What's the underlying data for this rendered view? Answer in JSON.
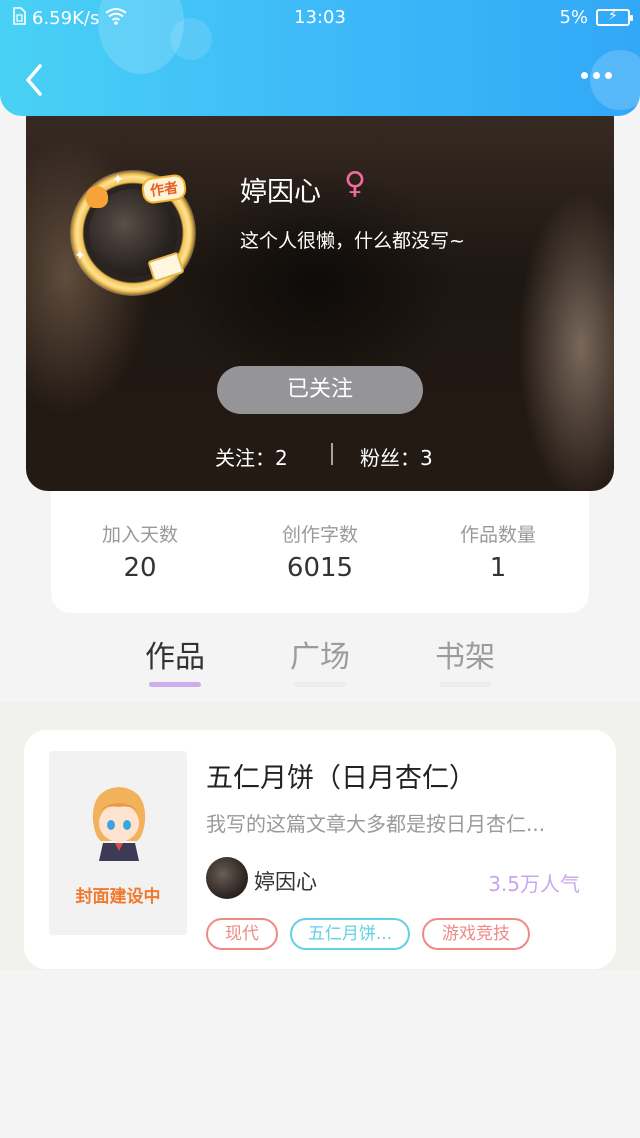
{
  "status_bar": {
    "network_speed": "6.59K/s",
    "time": "13:03",
    "battery": "5%"
  },
  "header": {
    "back_icon": "chevron-left-icon",
    "more_icon": "more-dots-icon"
  },
  "profile": {
    "avatar_badge": "作者",
    "username": "婷因心",
    "gender_symbol": "♀",
    "gender_color": "#f06a9b",
    "bio": "这个人很懒，什么都没写~",
    "follow_button": "已关注",
    "following_text": "关注：2",
    "fans_text": "粉丝：3"
  },
  "stats": [
    {
      "label": "加入天数",
      "value": "20"
    },
    {
      "label": "创作字数",
      "value": "6015"
    },
    {
      "label": "作品数量",
      "value": "1"
    }
  ],
  "tabs": [
    {
      "label": "作品",
      "active": true
    },
    {
      "label": "广场",
      "active": false
    },
    {
      "label": "书架",
      "active": false
    }
  ],
  "works": [
    {
      "cover_text": "封面建设中",
      "title": "五仁月饼（日月杏仁）",
      "description": "我写的这篇文章大多都是按日月杏仁...",
      "author": "婷因心",
      "popularity": "3.5万人气",
      "tags": [
        {
          "label": "现代",
          "color": "#ef8a84"
        },
        {
          "label": "五仁月饼...",
          "color": "#5fd3e3"
        },
        {
          "label": "游戏竞技",
          "color": "#ef8a84"
        }
      ]
    }
  ],
  "colors": {
    "accent": "#3fbcf8",
    "tab_indicator": "#c9b0ea",
    "popularity": "#c9a5ef"
  }
}
